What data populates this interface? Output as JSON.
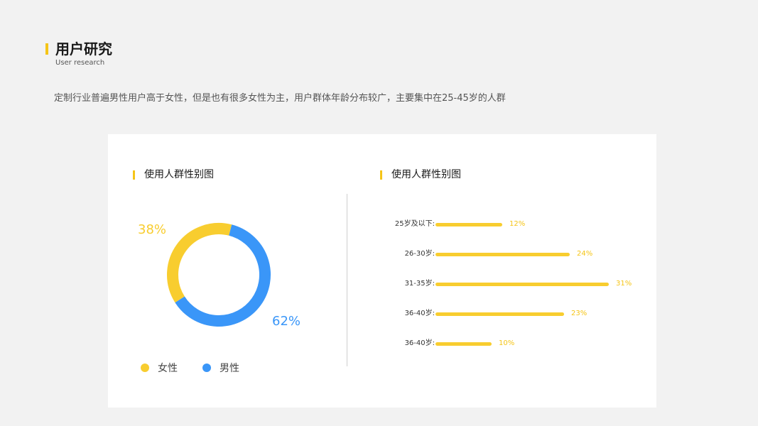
{
  "header": {
    "title": "用户研究",
    "subtitle": "User research",
    "description": "定制行业普遍男性用户高于女性，但是也有很多女性为主，用户群体年龄分布较广，主要集中在25-45岁的人群"
  },
  "colors": {
    "accent": "#f5c518",
    "female": "#f8cd2f",
    "male": "#3a96f8"
  },
  "chart_data": [
    {
      "type": "pie",
      "title": "使用人群性别图",
      "donut": true,
      "categories": [
        "女性",
        "男性"
      ],
      "values": [
        38,
        62
      ],
      "labels": [
        "38%",
        "62%"
      ],
      "legend": "bottom"
    },
    {
      "type": "bar",
      "orientation": "horizontal",
      "title": "使用人群性别图",
      "categories": [
        "25岁及以下:",
        "26-30岁:",
        "31-35岁:",
        "36-40岁:",
        "36-40岁:"
      ],
      "values": [
        12,
        24,
        31,
        23,
        10
      ],
      "labels": [
        "12%",
        "24%",
        "31%",
        "23%",
        "10%"
      ],
      "xlim": [
        0,
        31
      ]
    }
  ]
}
